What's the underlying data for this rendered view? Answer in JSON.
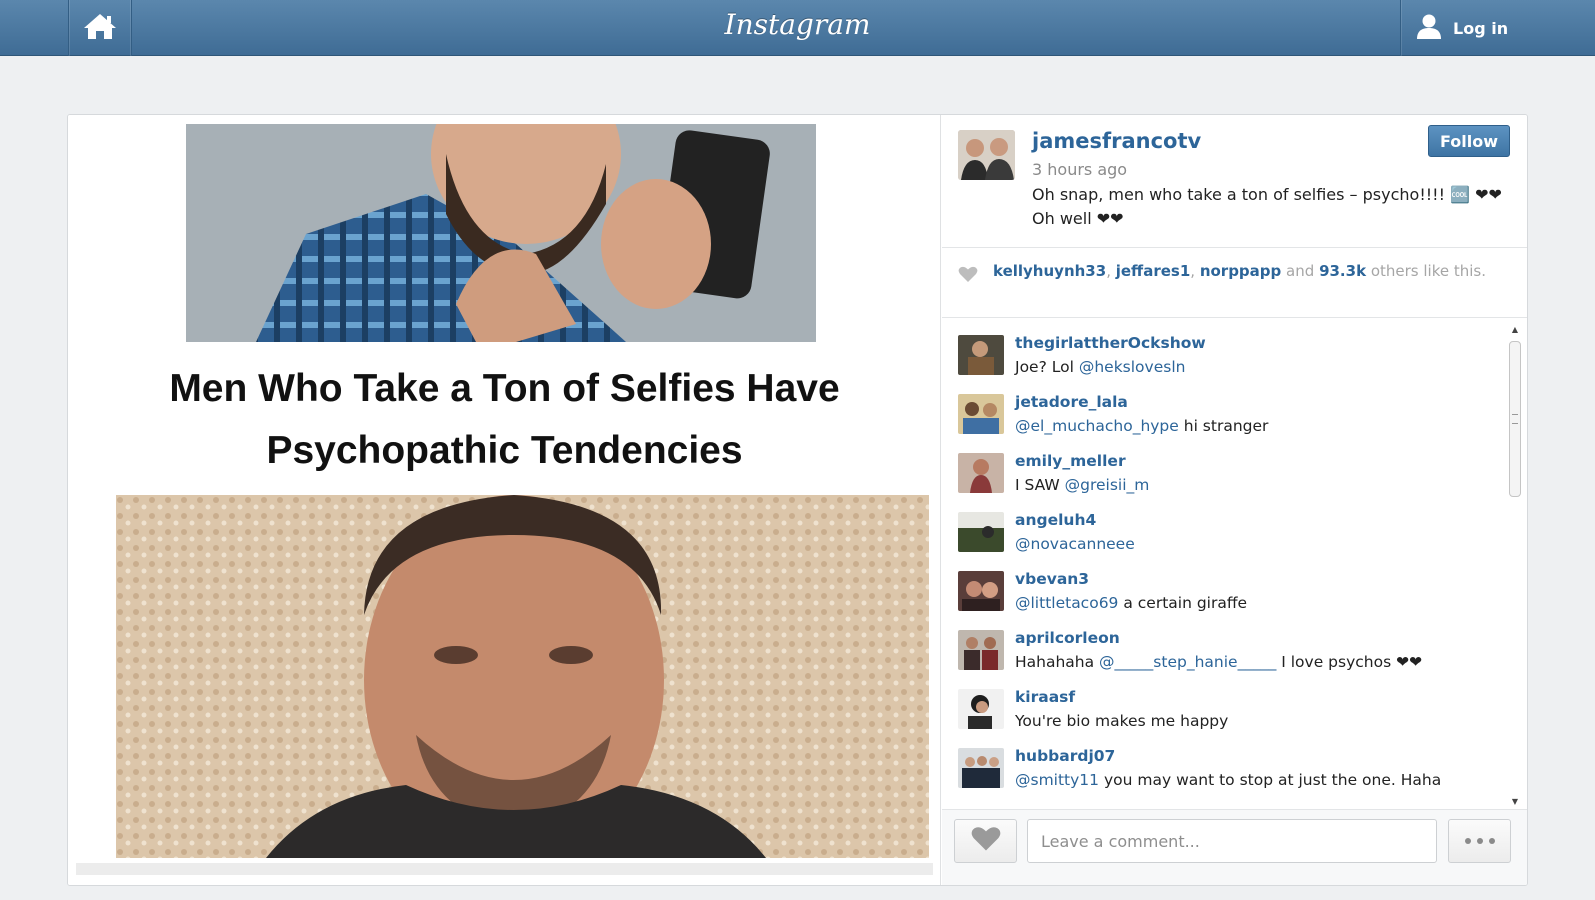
{
  "topbar": {
    "logo": "Instagram",
    "login_label": "Log in",
    "icons": [
      "home-icon",
      "user-icon"
    ]
  },
  "media": {
    "headline": "Men Who Take a Ton of Selfies Have Psychopathic Tendencies"
  },
  "post": {
    "username": "jamesfrancotv",
    "follow_label": "Follow",
    "time_ago": "3 hours ago",
    "caption": "Oh snap, men who take a ton of selfies – psycho!!!! 🆒 ❤❤Oh well ❤❤",
    "likes": {
      "users": [
        "kellyhuynh33",
        "jeffares1",
        "norppapp"
      ],
      "and": "and",
      "count": "93.3k",
      "suffix": "others like this."
    }
  },
  "comments": [
    {
      "user": "thegirlattherOckshow",
      "mention": "",
      "pre": "Joe? Lol ",
      "mention2": "@hekslovesln",
      "text": ""
    },
    {
      "user": "jetadore_lala",
      "pre": "",
      "mention2": "@el_muchacho_hype",
      "text": " hi stranger"
    },
    {
      "user": "emily_meller",
      "pre": "I SAW ",
      "mention2": "@greisii_m",
      "text": ""
    },
    {
      "user": "angeluh4",
      "pre": "",
      "mention2": "@novacanneee",
      "text": ""
    },
    {
      "user": "vbevan3",
      "pre": "",
      "mention2": "@littletaco69",
      "text": " a certain giraffe"
    },
    {
      "user": "aprilcorleon",
      "pre": "Hahahaha ",
      "mention2": "@_____step_hanie_____",
      "text": " I love psychos ❤❤"
    },
    {
      "user": "kiraasf",
      "pre": "You're bio makes me happy",
      "mention2": "",
      "text": ""
    },
    {
      "user": "hubbardj07",
      "pre": "",
      "mention2": "@smitty11",
      "text": " you may want to stop at just the one. Haha"
    }
  ],
  "footer": {
    "comment_placeholder": "Leave a comment...",
    "icons": [
      "heart-icon",
      "more-icon"
    ]
  },
  "colors": {
    "topbar": "#4a77a0",
    "link": "#2d6599",
    "follow": "#4a80b2"
  }
}
